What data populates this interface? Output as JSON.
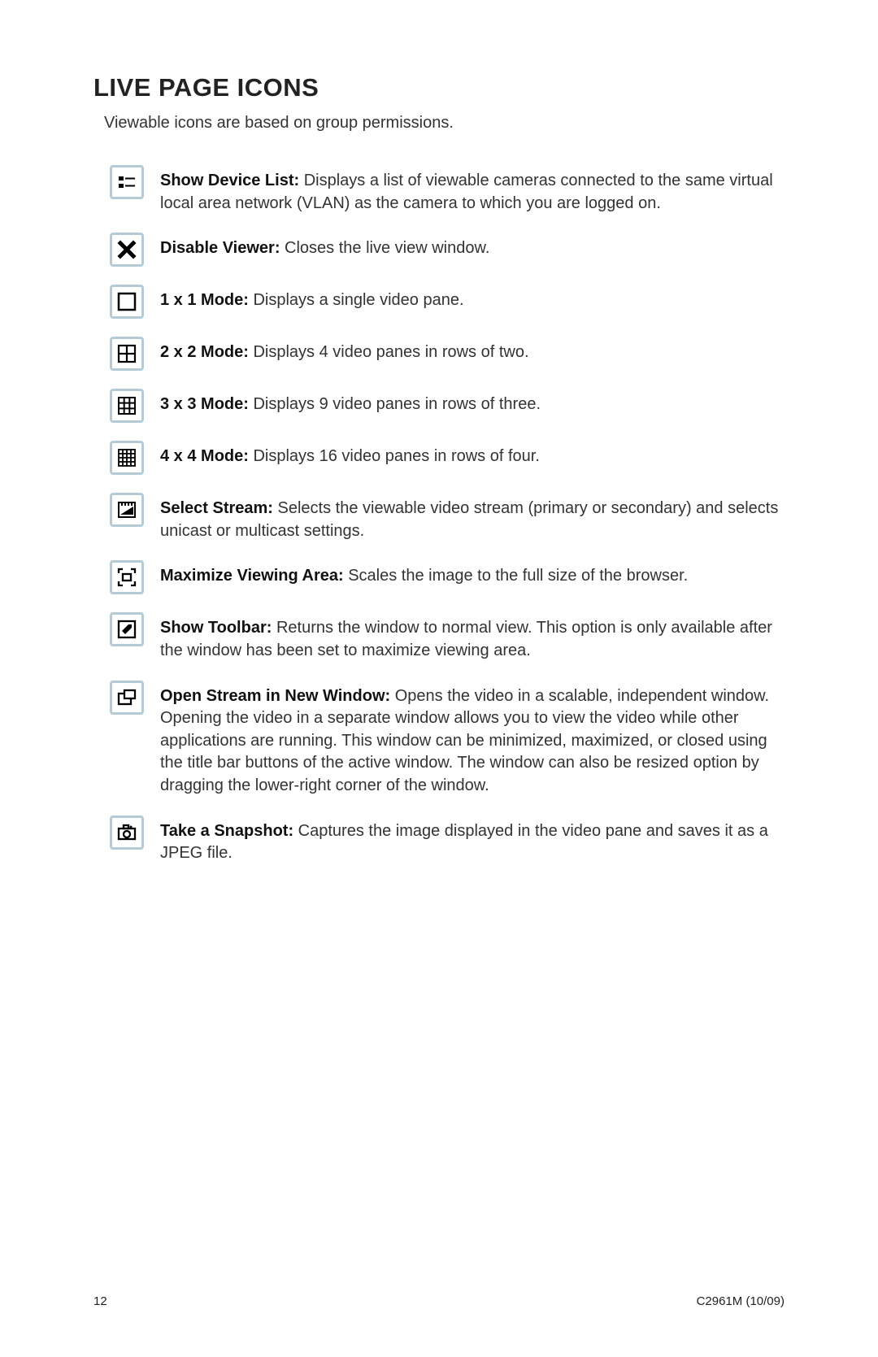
{
  "title": "LIVE PAGE ICONS",
  "subtitle": "Viewable icons are based on group permissions.",
  "icons": [
    {
      "term": "Show Device List:",
      "desc": " Displays a list of viewable cameras connected to the same virtual local area network (VLAN) as the camera to which you are logged on."
    },
    {
      "term": "Disable Viewer:",
      "desc": " Closes the live view window."
    },
    {
      "term": "1 x 1 Mode:",
      "desc": " Displays a single video pane."
    },
    {
      "term": "2 x 2 Mode:",
      "desc": " Displays 4 video panes in rows of two."
    },
    {
      "term": "3 x 3 Mode:",
      "desc": " Displays 9 video panes in rows of three."
    },
    {
      "term": "4 x 4 Mode:",
      "desc": " Displays 16 video panes in rows of four."
    },
    {
      "term": "Select Stream:",
      "desc": " Selects the viewable video stream (primary or secondary) and selects unicast or multicast settings."
    },
    {
      "term": "Maximize Viewing Area:",
      "desc": " Scales the image to the full size of the browser."
    },
    {
      "term": "Show Toolbar:",
      "desc": " Returns the window to normal view. This option is only available after the window has been set to maximize viewing area."
    },
    {
      "term": "Open Stream in New Window:",
      "desc": " Opens the video in a scalable, independent window. Opening the video in a separate window allows you to view the video while other applications are running. This window can be minimized, maximized, or closed using the title bar buttons of the active window. The window can also be resized option by dragging the lower-right corner of the window."
    },
    {
      "term": "Take a Snapshot:",
      "desc": " Captures the image displayed in the video pane and saves it as a JPEG file."
    }
  ],
  "footer": {
    "page": "12",
    "doc": "C2961M (10/09)"
  }
}
